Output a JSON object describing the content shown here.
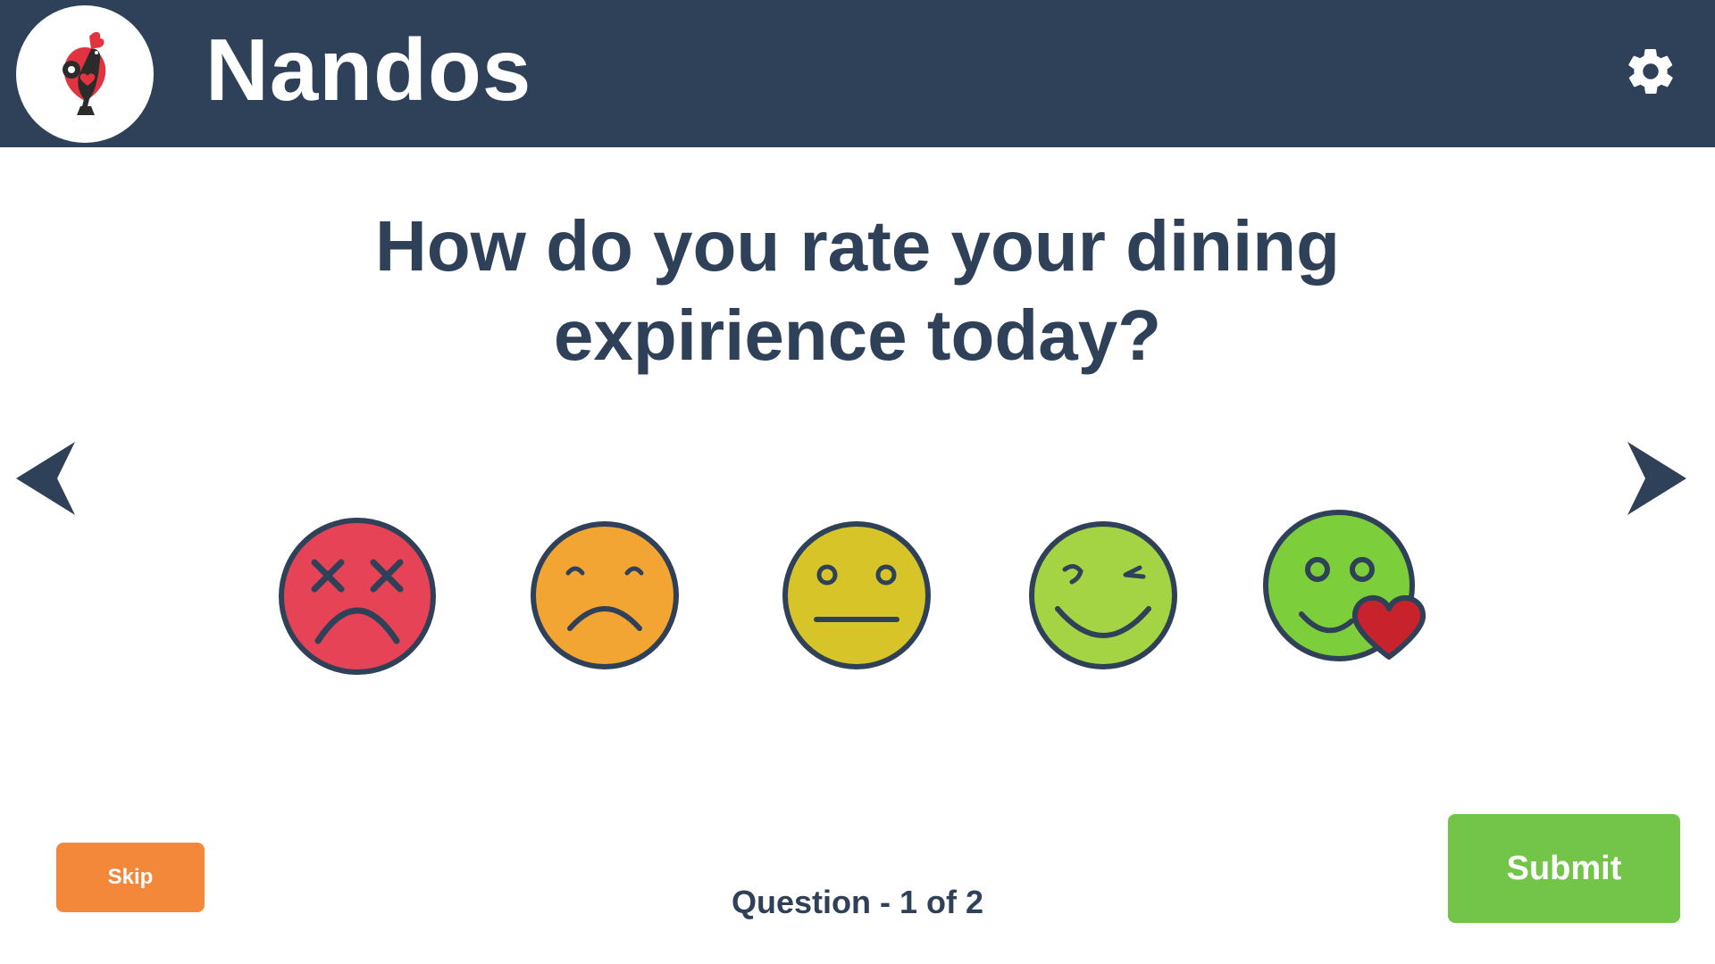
{
  "header": {
    "brand": "Nandos",
    "logo_icon": "rooster-logo-icon",
    "settings_icon": "gear-icon"
  },
  "survey": {
    "question": "How do you rate your dining expirience today?",
    "progress_text": "Question - 1 of 2",
    "question_number": 1,
    "question_total": 2
  },
  "navigation": {
    "prev_icon": "chevron-left-icon",
    "next_icon": "chevron-right-icon"
  },
  "ratings": [
    {
      "name": "very-bad",
      "icon": "dizzy-face-icon",
      "color": "#e64356"
    },
    {
      "name": "bad",
      "icon": "sad-face-icon",
      "color": "#f3a534"
    },
    {
      "name": "neutral",
      "icon": "neutral-face-icon",
      "color": "#d6c429"
    },
    {
      "name": "good",
      "icon": "wink-face-icon",
      "color": "#a4d444"
    },
    {
      "name": "excellent",
      "icon": "love-face-icon",
      "color": "#7ccf3a"
    }
  ],
  "actions": {
    "skip_label": "Skip",
    "submit_label": "Submit"
  },
  "colors": {
    "header_bg": "#2f4059",
    "text_primary": "#2f4059",
    "skip_bg": "#f3873a",
    "submit_bg": "#73c54a",
    "heart": "#c8232c"
  }
}
